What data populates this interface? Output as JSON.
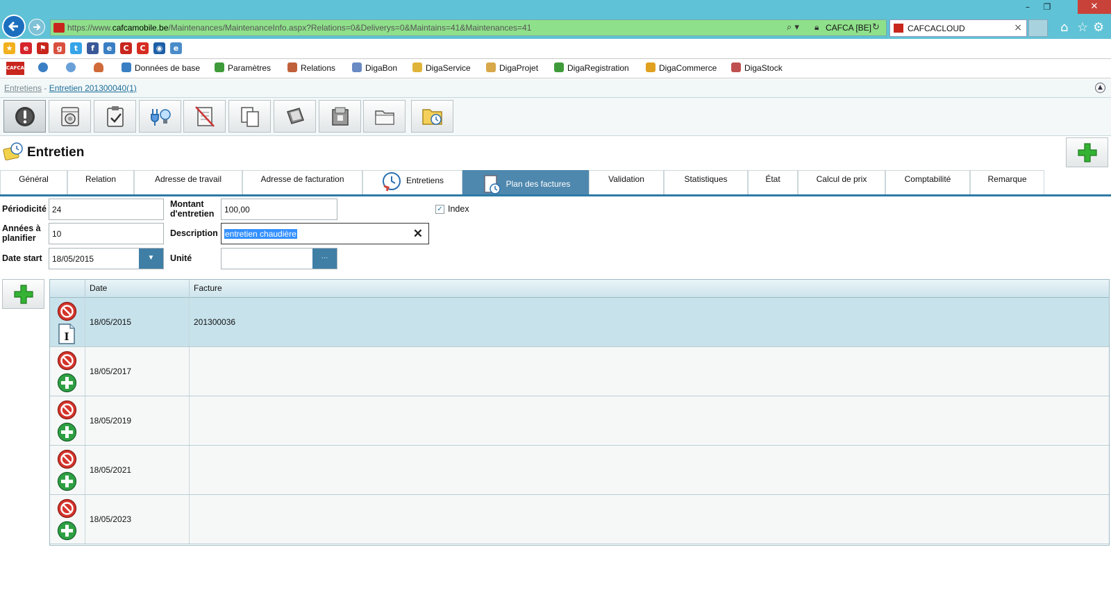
{
  "browser": {
    "url_prefix": "https://www.",
    "url_host": "cafcamobile.be",
    "url_path": "/Maintenances/MaintenanceInfo.aspx?Relations=0&Deliverys=0&Maintains=41&Maintenances=41",
    "cert_label": "CAFCA [BE]",
    "tab_title": "CAFCACLOUD",
    "tab_close": "×",
    "win_minimize": "–",
    "win_restore": "❐",
    "win_close": "✕"
  },
  "favorites": [
    {
      "name": "favorite-star-icon",
      "color": "#f2b01e",
      "glyph": "★"
    },
    {
      "name": "favorite-e-icon",
      "color": "#d6242a",
      "glyph": "e"
    },
    {
      "name": "favorite-flag-icon",
      "color": "#c8261d",
      "glyph": "⚑"
    },
    {
      "name": "favorite-gplus-icon",
      "color": "#d9503f",
      "glyph": "g"
    },
    {
      "name": "favorite-twitter-icon",
      "color": "#35a4e8",
      "glyph": "t"
    },
    {
      "name": "favorite-facebook-icon",
      "color": "#3b5998",
      "glyph": "f"
    },
    {
      "name": "favorite-ie-icon",
      "color": "#3a7fc4",
      "glyph": "e"
    },
    {
      "name": "favorite-cafca-icon",
      "color": "#c8261d",
      "glyph": "C"
    },
    {
      "name": "favorite-cafca-c-icon",
      "color": "#d62d22",
      "glyph": "C"
    },
    {
      "name": "favorite-globe-icon",
      "color": "#1e5fa8",
      "glyph": "◉"
    },
    {
      "name": "favorite-ie2-icon",
      "color": "#4a8cc9",
      "glyph": "e"
    }
  ],
  "menu": {
    "logo": "CAFCA",
    "items": [
      {
        "label": "Données de base",
        "color": "#3a7fc4"
      },
      {
        "label": "Paramètres",
        "color": "#3f9a3a"
      },
      {
        "label": "Relations",
        "color": "#c0603a"
      },
      {
        "label": "DigaBon",
        "color": "#6a8ac4"
      },
      {
        "label": "DigaService",
        "color": "#e0b43a"
      },
      {
        "label": "DigaProjet",
        "color": "#d8a84a"
      },
      {
        "label": "DigaRegistration",
        "color": "#3f9a3a"
      },
      {
        "label": "DigaCommerce",
        "color": "#e0a020"
      },
      {
        "label": "DigaStock",
        "color": "#c05050"
      }
    ]
  },
  "breadcrumb": {
    "first": "Entretiens",
    "separator": " - ",
    "second": "Entretien 201300040(1)",
    "collapse": "▲"
  },
  "page": {
    "title": "Entretien"
  },
  "tabs": [
    {
      "label": "Général"
    },
    {
      "label": "Relation"
    },
    {
      "label": "Adresse de travail"
    },
    {
      "label": "Adresse de facturation"
    },
    {
      "label": "Entretiens"
    },
    {
      "label": "Plan des factures",
      "selected": true
    },
    {
      "label": "Validation"
    },
    {
      "label": "Statistiques"
    },
    {
      "label": "État"
    },
    {
      "label": "Calcul de prix"
    },
    {
      "label": "Comptabilité"
    },
    {
      "label": "Remarque"
    }
  ],
  "form": {
    "periodicite_label": "Périodicité",
    "periodicite_value": "24",
    "annees_label_1": "Années à",
    "annees_label_2": "planifier",
    "annees_value": "10",
    "date_start_label": "Date start",
    "date_start_value": "18/05/2015",
    "montant_label_1": "Montant",
    "montant_label_2": "d'entretien",
    "montant_value": "100,00",
    "description_label": "Description",
    "description_value": "entretien chaudière",
    "unite_label": "Unité",
    "unite_value": "",
    "unite_button": "···",
    "index_label": "Index",
    "index_checked": true,
    "checkmark": "✓",
    "clear_glyph": "✕",
    "dropdown_glyph": "▼"
  },
  "grid": {
    "headers": {
      "date": "Date",
      "facture": "Facture"
    },
    "rows": [
      {
        "date": "18/05/2015",
        "facture": "201300036"
      },
      {
        "date": "18/05/2017",
        "facture": ""
      },
      {
        "date": "18/05/2019",
        "facture": ""
      },
      {
        "date": "18/05/2021",
        "facture": ""
      },
      {
        "date": "18/05/2023",
        "facture": ""
      }
    ]
  },
  "colors": {
    "accent": "#2d7aa6",
    "selected_tab": "#4f88ae",
    "selected_row": "#c7e2eb",
    "delete_red": "#d4342b",
    "add_green": "#2ea043"
  }
}
